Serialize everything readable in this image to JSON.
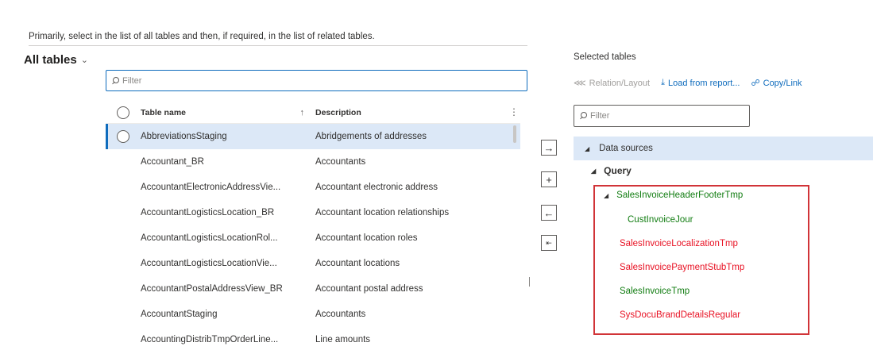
{
  "instruction": "Primarily, select in the list of all tables and then, if required, in the list of related tables.",
  "all_tables": {
    "title": "All tables",
    "filter_placeholder": "Filter",
    "columns": {
      "name": "Table name",
      "description": "Description"
    },
    "rows": [
      {
        "name": "AbbreviationsStaging",
        "description": "Abridgements of addresses"
      },
      {
        "name": "Accountant_BR",
        "description": "Accountants"
      },
      {
        "name": "AccountantElectronicAddressVie...",
        "description": "Accountant electronic address"
      },
      {
        "name": "AccountantLogisticsLocation_BR",
        "description": "Accountant location relationships"
      },
      {
        "name": "AccountantLogisticsLocationRol...",
        "description": "Accountant location roles"
      },
      {
        "name": "AccountantLogisticsLocationVie...",
        "description": "Accountant locations"
      },
      {
        "name": "AccountantPostalAddressView_BR",
        "description": "Accountant postal address"
      },
      {
        "name": "AccountantStaging",
        "description": "Accountants"
      },
      {
        "name": "AccountingDistribTmpOrderLine...",
        "description": "Line amounts"
      }
    ]
  },
  "middle_buttons": {
    "add": "→",
    "add_related": "+",
    "remove": "←",
    "remove_all": "⇤"
  },
  "selected_tables": {
    "title": "Selected tables",
    "toolbar": {
      "relation_layout": "Relation/Layout",
      "load_from_report": "Load from report...",
      "copy_link": "Copy/Link"
    },
    "filter_placeholder": "Filter",
    "tree": {
      "root": "Data sources",
      "query": "Query",
      "header_footer": "SalesInvoiceHeaderFooterTmp",
      "cust_invoice": "CustInvoiceJour",
      "localization": "SalesInvoiceLocalizationTmp",
      "payment_stub": "SalesInvoicePaymentStubTmp",
      "invoice_tmp": "SalesInvoiceTmp",
      "docu_brand": "SysDocuBrandDetailsRegular"
    }
  },
  "colors": {
    "accent": "#0f6cbd",
    "selection": "#dce8f7",
    "green_text": "#107c10",
    "red_text": "#e81123",
    "highlight_border": "#d13438"
  },
  "icons": {
    "chevron": "chevron-down-icon",
    "search": "search-icon",
    "sort": "sort-ascending-icon",
    "more": "more-vertical-icon",
    "relation": "relation-icon",
    "download": "download-icon",
    "link": "link-icon",
    "expand": "triangle-expanded-icon"
  }
}
